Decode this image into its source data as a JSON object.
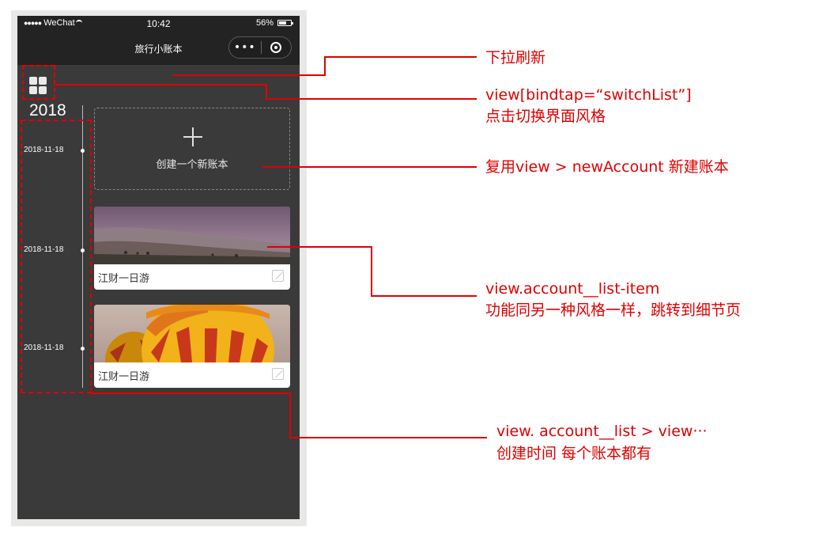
{
  "status_bar": {
    "signal": "●●●●●",
    "carrier": "WeChat",
    "time": "10:42",
    "battery": "56%"
  },
  "nav_bar": {
    "title": "旅行小账本",
    "more": "•••"
  },
  "timeline": {
    "year": "2018",
    "dates": [
      "2018-11-18",
      "2018-11-18",
      "2018-11-18"
    ]
  },
  "new_account": {
    "label": "创建一个新账本"
  },
  "accounts": [
    {
      "title": "江财一日游",
      "image": "landscape-photo"
    },
    {
      "title": "江财一日游",
      "image": "hot-air-balloon-photo"
    }
  ],
  "annotations": {
    "pull_refresh": "下拉刷新",
    "switch_line1": "view[bindtap=“switchList”]",
    "switch_line2": "点击切换界面风格",
    "new_account": "复用view > newAccount 新建账本",
    "list_item_line1": "view.account__list-item",
    "list_item_line2": "功能同另一种风格一样，跳转到细节页",
    "list_line1": "view. account__list > view···",
    "list_line2": "创建时间 每个账本都有"
  },
  "colors": {
    "annotation": "#e00000",
    "phone_bg": "#3a3a3a",
    "nav_bg": "#232323"
  }
}
